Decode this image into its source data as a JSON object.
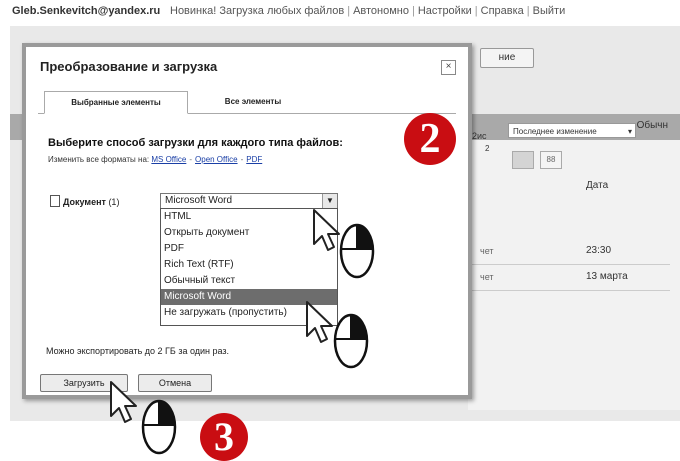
{
  "topbar": {
    "user": "Gleb.Senkevitch@yandex.ru",
    "nav": [
      "Новинка! Загрузка любых файлов",
      "Автономно",
      "Настройки",
      "Справка",
      "Выйти"
    ]
  },
  "background": {
    "button_label": "ние",
    "header_word": "Обычн",
    "select_label": "Последнее изменение",
    "small1": "2ис",
    "small2": "2",
    "view2_label": "88",
    "date_col": "Дата",
    "rows": [
      {
        "c1": "чет",
        "c2": "23:30"
      },
      {
        "c1": "чет",
        "c2": "13 марта"
      }
    ]
  },
  "dialog": {
    "title": "Преобразование и загрузка",
    "close_glyph": "×",
    "tabs": [
      "Выбранные элементы",
      "Все элементы"
    ],
    "heading": "Выберите способ загрузки для каждого типа файлов:",
    "links_prefix": "Изменить все форматы на:",
    "links": [
      "MS Office",
      "Open Office",
      "PDF"
    ],
    "doc_label": "Документ",
    "doc_count": "(1)",
    "selected_value": "Microsoft Word",
    "options": [
      "HTML",
      "Открыть документ",
      "PDF",
      "Rich Text (RTF)",
      "Обычный текст",
      "Microsoft Word",
      "Не загружать (пропустить)"
    ],
    "selected_index": 5,
    "note": "Можно экспортировать до 2 ГБ за один раз.",
    "upload_label": "Загрузить",
    "cancel_label": "Отмена"
  },
  "markers": {
    "step2": "2",
    "step3": "3",
    "color": "#c90d12"
  }
}
